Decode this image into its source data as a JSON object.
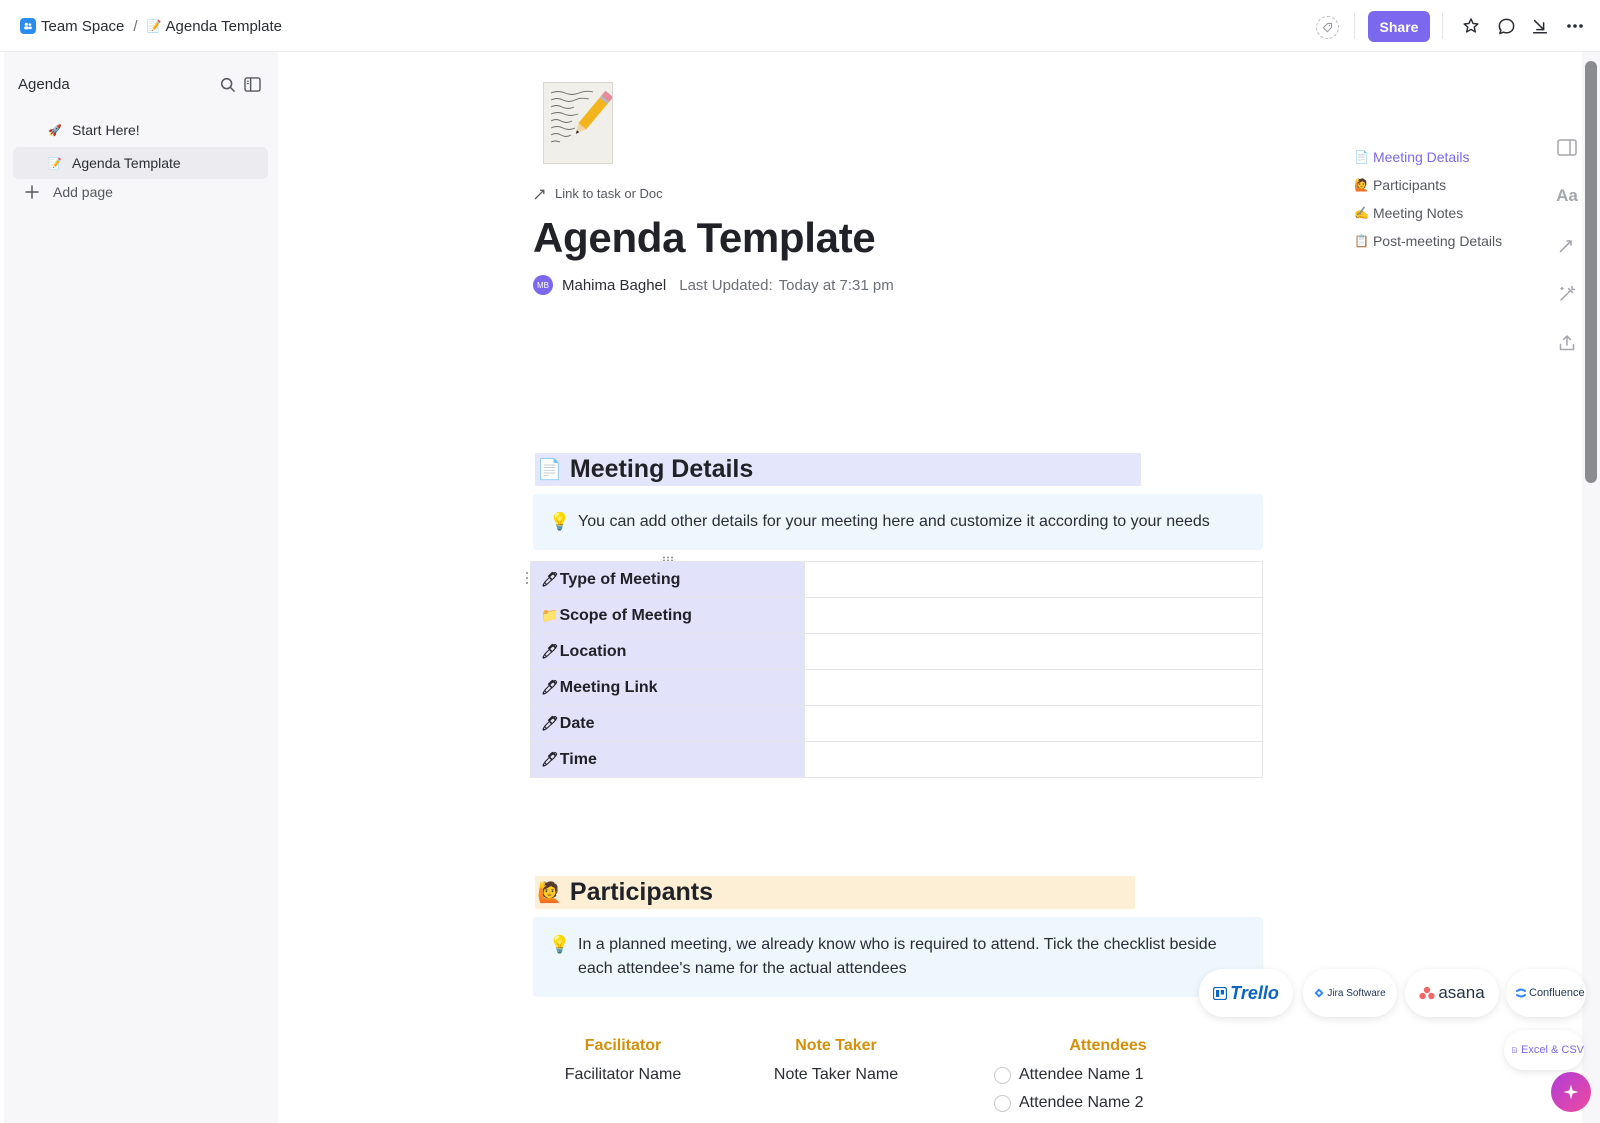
{
  "breadcrumb": {
    "space": "Team Space",
    "separator": "/",
    "doc_emoji": "📝",
    "doc": "Agenda Template"
  },
  "topbar": {
    "share_label": "Share",
    "icons": [
      "tag-icon",
      "star-icon",
      "comment-icon",
      "collapse-arrow-icon",
      "more-icon"
    ]
  },
  "sidebar": {
    "title": "Agenda",
    "items": [
      {
        "emoji": "🚀",
        "label": "Start Here!"
      },
      {
        "emoji": "📝",
        "label": "Agenda Template"
      }
    ],
    "add_page": "Add page"
  },
  "doc": {
    "link_label": "Link to task or Doc",
    "title": "Agenda Template",
    "author_initials": "MB",
    "author": "Mahima Baghel",
    "updated_label": "Last Updated:",
    "updated_value": "Today at 7:31 pm"
  },
  "meeting_details": {
    "emoji": "📄",
    "heading": "Meeting Details",
    "callout": "You can add other details for your meeting here and customize it according to your needs",
    "rows": [
      {
        "emoji": "🖊",
        "label": "Type of Meeting",
        "value": ""
      },
      {
        "emoji": "📁",
        "label": "Scope of Meeting",
        "value": ""
      },
      {
        "emoji": "🖊",
        "label": "Location",
        "value": ""
      },
      {
        "emoji": "🖊",
        "label": "Meeting Link",
        "value": ""
      },
      {
        "emoji": "🖊",
        "label": "Date",
        "value": ""
      },
      {
        "emoji": "🖊",
        "label": "Time",
        "value": ""
      }
    ]
  },
  "participants": {
    "emoji": "🙋",
    "heading": "Participants",
    "callout": "In a planned meeting, we already know who is required to attend. Tick the checklist beside each attendee's name for the actual attendees",
    "facilitator_head": "Facilitator",
    "facilitator": "Facilitator Name",
    "notetaker_head": "Note Taker",
    "notetaker": "Note Taker Name",
    "attendees_head": "Attendees",
    "attendees": [
      "Attendee Name 1",
      "Attendee Name 2"
    ]
  },
  "toc": [
    {
      "emoji": "📄",
      "label": "Meeting Details"
    },
    {
      "emoji": "🙋",
      "label": "Participants"
    },
    {
      "emoji": "✍️",
      "label": "Meeting Notes"
    },
    {
      "emoji": "📋",
      "label": "Post-meeting Details"
    }
  ],
  "integrations": [
    "Trello",
    "Jira Software",
    "asana",
    "Confluence",
    "Excel & CSV"
  ],
  "colors": {
    "accent": "#7b68ee",
    "details_heading_bg": "#e4e6fb",
    "participants_heading_bg": "#fdefd5",
    "callout_bg": "#eef6fe",
    "table_key_bg": "#e3e2fb",
    "column_head": "#d4900a"
  }
}
